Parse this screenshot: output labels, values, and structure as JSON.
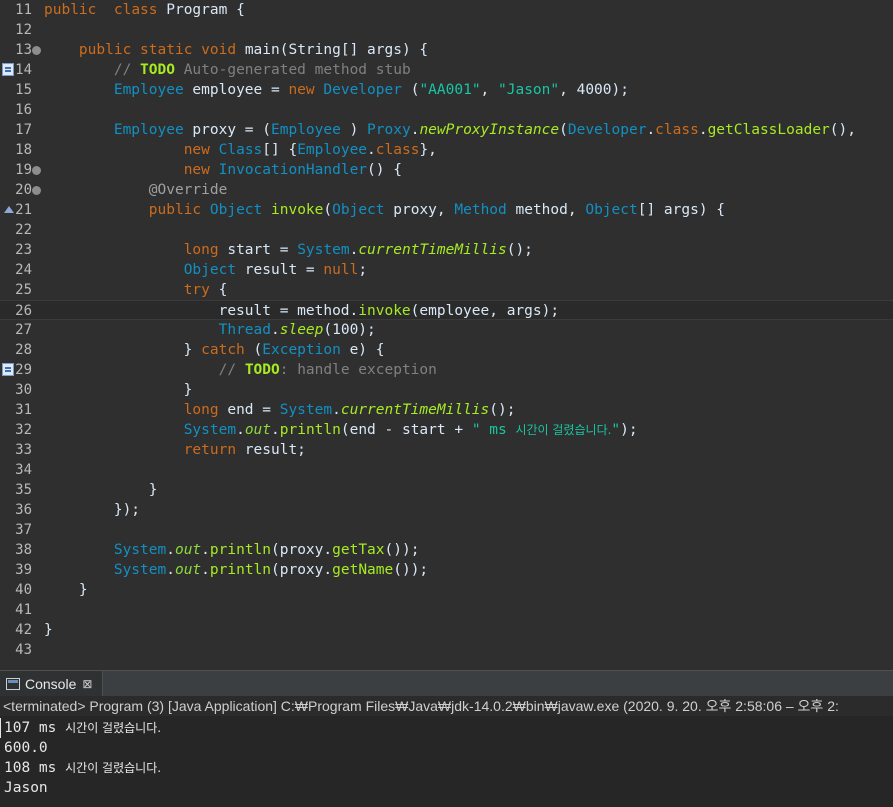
{
  "editor": {
    "lines": [
      {
        "n": "11",
        "segs": [
          [
            "kw",
            "public"
          ],
          [
            "",
            "  "
          ],
          [
            "kw",
            "class"
          ],
          [
            "",
            " Program {"
          ]
        ]
      },
      {
        "n": "12",
        "segs": []
      },
      {
        "n": "13",
        "fold": true,
        "segs": [
          [
            "",
            "    "
          ],
          [
            "kw",
            "public"
          ],
          [
            "",
            " "
          ],
          [
            "kw",
            "static"
          ],
          [
            "",
            " "
          ],
          [
            "kw",
            "void"
          ],
          [
            "",
            " main(String[] args) {"
          ]
        ]
      },
      {
        "n": "14",
        "marker": "task",
        "segs": [
          [
            "",
            "        "
          ],
          [
            "cm",
            "// "
          ],
          [
            "td",
            "TODO"
          ],
          [
            "cm",
            " Auto-generated method stub"
          ]
        ]
      },
      {
        "n": "15",
        "segs": [
          [
            "",
            "        "
          ],
          [
            "ty",
            "Employee"
          ],
          [
            "",
            " employee = "
          ],
          [
            "kw",
            "new"
          ],
          [
            "",
            " "
          ],
          [
            "ty",
            "Developer"
          ],
          [
            "",
            " ("
          ],
          [
            "st",
            "\"AA001\""
          ],
          [
            "",
            ", "
          ],
          [
            "st",
            "\"Jason\""
          ],
          [
            "",
            ", 4000);"
          ]
        ]
      },
      {
        "n": "16",
        "segs": []
      },
      {
        "n": "17",
        "segs": [
          [
            "",
            "        "
          ],
          [
            "ty",
            "Employee"
          ],
          [
            "",
            " proxy = ("
          ],
          [
            "ty",
            "Employee"
          ],
          [
            "",
            " ) "
          ],
          [
            "ty",
            "Proxy"
          ],
          [
            "",
            "."
          ],
          [
            "mt it",
            "newProxyInstance"
          ],
          [
            "",
            "("
          ],
          [
            "ty",
            "Developer"
          ],
          [
            "",
            "."
          ],
          [
            "kw",
            "class"
          ],
          [
            "",
            "."
          ],
          [
            "mt",
            "getClassLoader"
          ],
          [
            "",
            "(),"
          ]
        ]
      },
      {
        "n": "18",
        "segs": [
          [
            "",
            "                "
          ],
          [
            "kw",
            "new"
          ],
          [
            "",
            " "
          ],
          [
            "ty",
            "Class"
          ],
          [
            "",
            "[] {"
          ],
          [
            "ty",
            "Employee"
          ],
          [
            "",
            "."
          ],
          [
            "kw",
            "class"
          ],
          [
            "",
            "},"
          ]
        ]
      },
      {
        "n": "19",
        "fold": true,
        "segs": [
          [
            "",
            "                "
          ],
          [
            "kw",
            "new"
          ],
          [
            "",
            " "
          ],
          [
            "ty",
            "InvocationHandler"
          ],
          [
            "",
            "() {"
          ]
        ]
      },
      {
        "n": "20",
        "fold": true,
        "segs": [
          [
            "",
            "            "
          ],
          [
            "an",
            "@Override"
          ]
        ]
      },
      {
        "n": "21",
        "marker": "override",
        "segs": [
          [
            "",
            "            "
          ],
          [
            "kw",
            "public"
          ],
          [
            "",
            " "
          ],
          [
            "ty",
            "Object"
          ],
          [
            "",
            " "
          ],
          [
            "mt",
            "invoke"
          ],
          [
            "",
            "("
          ],
          [
            "ty",
            "Object"
          ],
          [
            "",
            " proxy, "
          ],
          [
            "ty",
            "Method"
          ],
          [
            "",
            " method, "
          ],
          [
            "ty",
            "Object"
          ],
          [
            "",
            "[] args) {"
          ]
        ]
      },
      {
        "n": "22",
        "segs": []
      },
      {
        "n": "23",
        "segs": [
          [
            "",
            "                "
          ],
          [
            "kw",
            "long"
          ],
          [
            "",
            " start = "
          ],
          [
            "ty",
            "System"
          ],
          [
            "",
            "."
          ],
          [
            "mt it",
            "currentTimeMillis"
          ],
          [
            "",
            "();"
          ]
        ]
      },
      {
        "n": "24",
        "segs": [
          [
            "",
            "                "
          ],
          [
            "ty",
            "Object"
          ],
          [
            "",
            " result = "
          ],
          [
            "kw",
            "null"
          ],
          [
            "",
            ";"
          ]
        ]
      },
      {
        "n": "25",
        "segs": [
          [
            "",
            "                "
          ],
          [
            "kw",
            "try"
          ],
          [
            "",
            " {"
          ]
        ]
      },
      {
        "n": "26",
        "current": true,
        "segs": [
          [
            "",
            "                    result = method."
          ],
          [
            "mt",
            "invoke"
          ],
          [
            "",
            "(employee, args);"
          ]
        ]
      },
      {
        "n": "27",
        "segs": [
          [
            "",
            "                    "
          ],
          [
            "ty",
            "Thread"
          ],
          [
            "",
            "."
          ],
          [
            "mt it",
            "sleep"
          ],
          [
            "",
            "(100);"
          ]
        ]
      },
      {
        "n": "28",
        "segs": [
          [
            "",
            "                } "
          ],
          [
            "kw",
            "catch"
          ],
          [
            "",
            " ("
          ],
          [
            "ty",
            "Exception"
          ],
          [
            "",
            " e) {"
          ]
        ]
      },
      {
        "n": "29",
        "marker": "task",
        "segs": [
          [
            "",
            "                    "
          ],
          [
            "cm",
            "// "
          ],
          [
            "td",
            "TODO"
          ],
          [
            "cm",
            ": handle exception"
          ]
        ]
      },
      {
        "n": "30",
        "segs": [
          [
            "",
            "                }"
          ]
        ]
      },
      {
        "n": "31",
        "segs": [
          [
            "",
            "                "
          ],
          [
            "kw",
            "long"
          ],
          [
            "",
            " end = "
          ],
          [
            "ty",
            "System"
          ],
          [
            "",
            "."
          ],
          [
            "mt it",
            "currentTimeMillis"
          ],
          [
            "",
            "();"
          ]
        ]
      },
      {
        "n": "32",
        "segs": [
          [
            "",
            "                "
          ],
          [
            "ty",
            "System"
          ],
          [
            "",
            "."
          ],
          [
            "fi it",
            "out"
          ],
          [
            "",
            "."
          ],
          [
            "mt",
            "println"
          ],
          [
            "",
            "(end - start + "
          ],
          [
            "st",
            "\" ms "
          ],
          [
            "st ko",
            "시간이 걸렸습니다."
          ],
          [
            "st",
            "\""
          ],
          [
            "",
            ");"
          ]
        ]
      },
      {
        "n": "33",
        "segs": [
          [
            "",
            "                "
          ],
          [
            "kw",
            "return"
          ],
          [
            "",
            " result;"
          ]
        ]
      },
      {
        "n": "34",
        "segs": []
      },
      {
        "n": "35",
        "segs": [
          [
            "",
            "            }"
          ]
        ]
      },
      {
        "n": "36",
        "segs": [
          [
            "",
            "        });"
          ]
        ]
      },
      {
        "n": "37",
        "segs": []
      },
      {
        "n": "38",
        "segs": [
          [
            "",
            "        "
          ],
          [
            "ty",
            "System"
          ],
          [
            "",
            "."
          ],
          [
            "fi it",
            "out"
          ],
          [
            "",
            "."
          ],
          [
            "mt",
            "println"
          ],
          [
            "",
            "(proxy."
          ],
          [
            "mt",
            "getTax"
          ],
          [
            "",
            "());"
          ]
        ]
      },
      {
        "n": "39",
        "segs": [
          [
            "",
            "        "
          ],
          [
            "ty",
            "System"
          ],
          [
            "",
            "."
          ],
          [
            "fi it",
            "out"
          ],
          [
            "",
            "."
          ],
          [
            "mt",
            "println"
          ],
          [
            "",
            "(proxy."
          ],
          [
            "mt",
            "getName"
          ],
          [
            "",
            "());"
          ]
        ]
      },
      {
        "n": "40",
        "segs": [
          [
            "",
            "    }"
          ]
        ]
      },
      {
        "n": "41",
        "segs": []
      },
      {
        "n": "42",
        "segs": [
          [
            "",
            "}"
          ]
        ]
      },
      {
        "n": "43",
        "segs": []
      }
    ]
  },
  "console": {
    "tab_label": "Console",
    "close_glyph": "⊠",
    "header": "<terminated> Program (3) [Java Application] C:₩Program Files₩Java₩jdk-14.0.2₩bin₩javaw.exe  (2020. 9. 20. 오후 2:58:06 – 오후 2:",
    "output": [
      {
        "text": "107 ms ",
        "ko": "시간이 걸렸습니다."
      },
      {
        "text": "600.0",
        "ko": ""
      },
      {
        "text": "108 ms ",
        "ko": "시간이 걸렸습니다."
      },
      {
        "text": "Jason",
        "ko": ""
      }
    ]
  },
  "colors": {
    "editor_bg": "#2f2f2f",
    "keyword": "#cc6c1d",
    "type": "#1290c3",
    "string": "#17c6a3",
    "method": "#a7ec21",
    "comment": "#808080"
  }
}
